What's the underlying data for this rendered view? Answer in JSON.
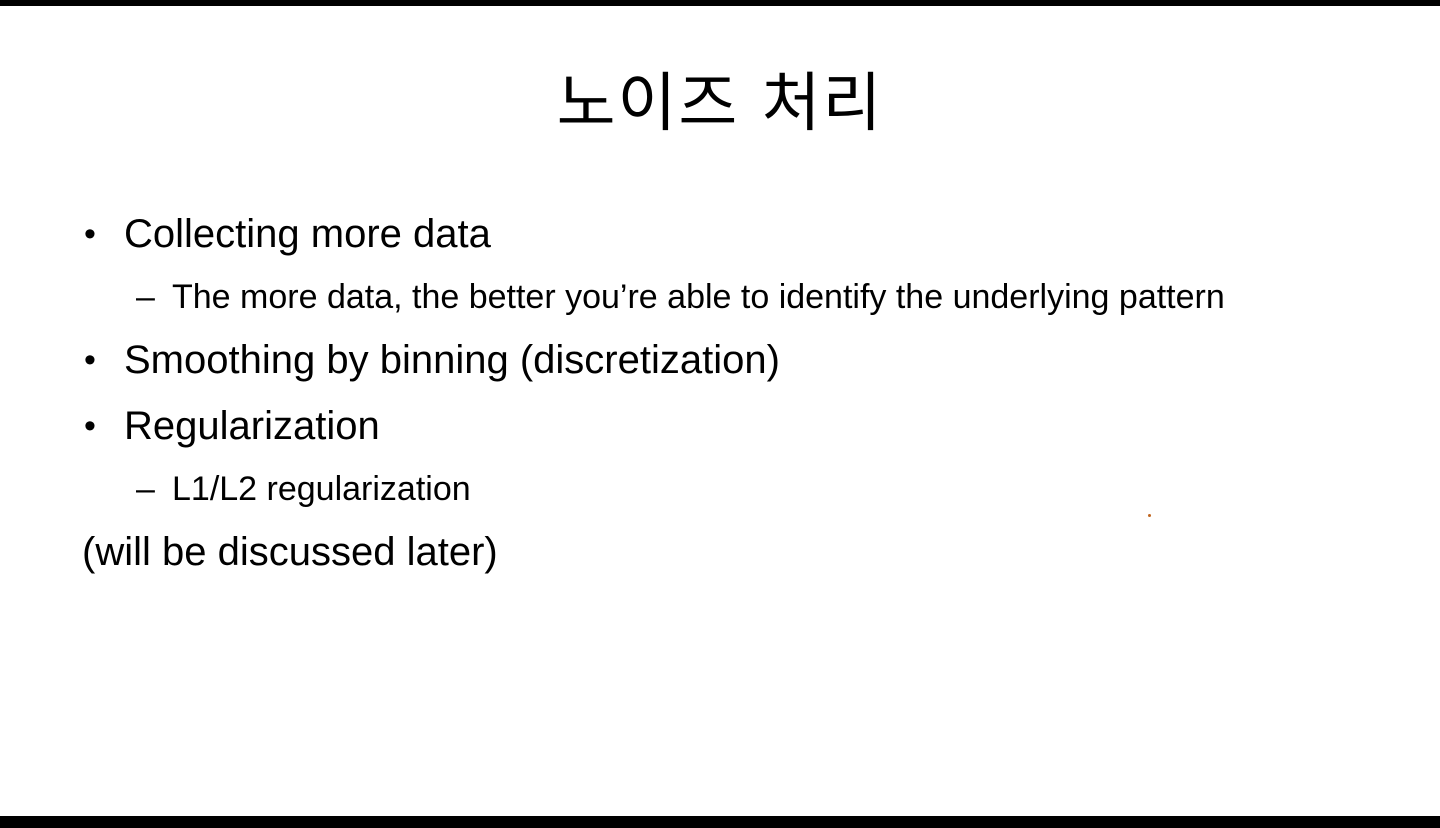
{
  "slide": {
    "title": "노이즈 처리",
    "bullet_glyph": "•",
    "dash_glyph": "–",
    "items": [
      {
        "text": "Collecting more data",
        "sub": [
          "The more data, the better you’re able to identify the underlying pattern"
        ]
      },
      {
        "text": "Smoothing by binning (discretization)",
        "sub": []
      },
      {
        "text": "Regularization",
        "sub": [
          "L1/L2 regularization"
        ]
      }
    ],
    "footnote": "(will be discussed later)",
    "colors": {
      "background": "#ffffff",
      "letterbox": "#000000",
      "text": "#000000",
      "pointer_dot": "#c0661f"
    }
  }
}
